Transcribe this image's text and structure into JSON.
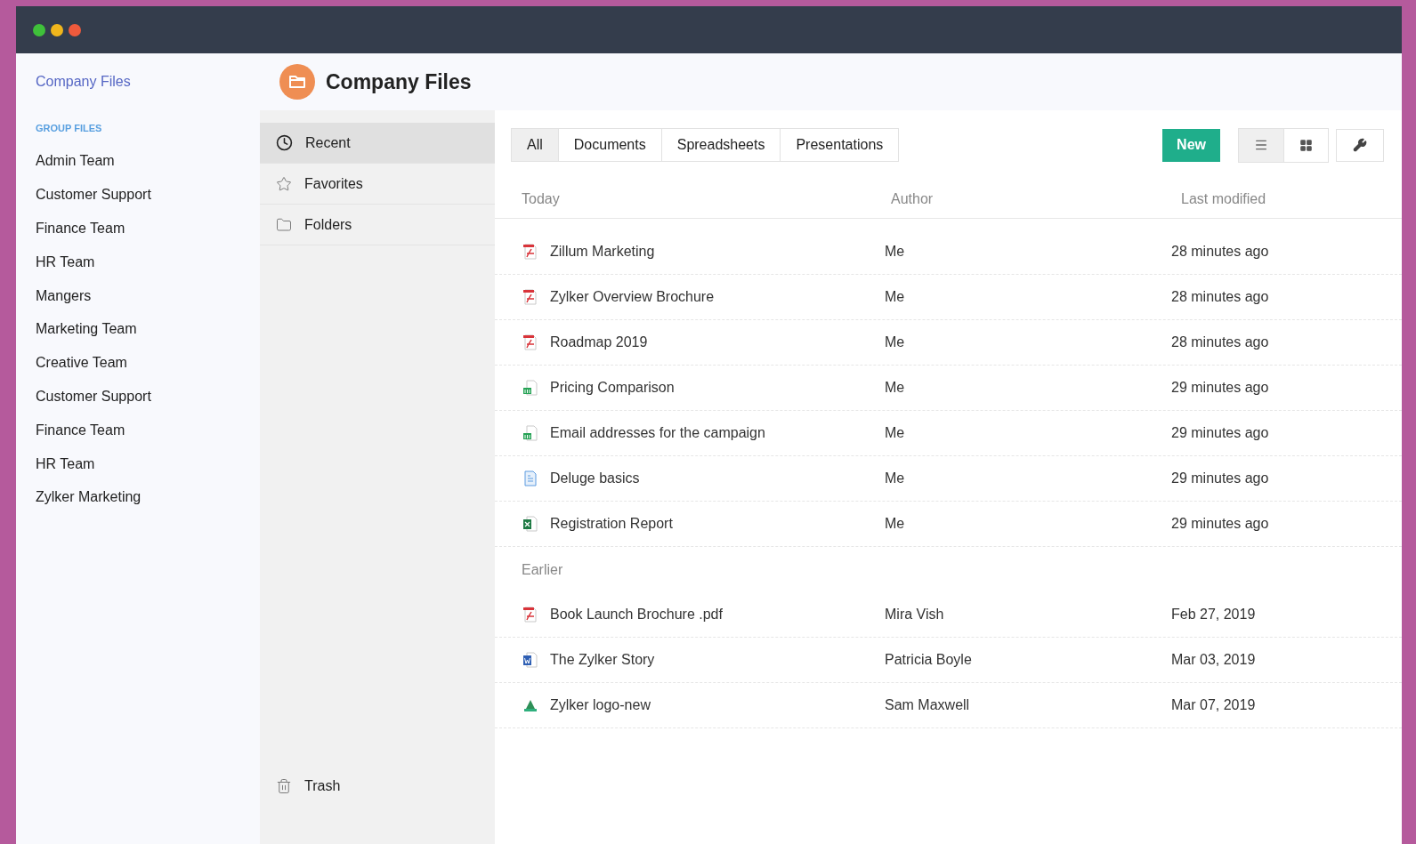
{
  "window": {
    "controls": [
      {
        "color": "#3fc13a"
      },
      {
        "color": "#f0b61c"
      },
      {
        "color": "#ef5a3c"
      }
    ]
  },
  "sidebar": {
    "title": "Company Files",
    "section_label": "GROUP FILES",
    "items": [
      {
        "label": "Admin Team"
      },
      {
        "label": "Customer Support"
      },
      {
        "label": "Finance Team"
      },
      {
        "label": "HR Team"
      },
      {
        "label": "Mangers"
      },
      {
        "label": "Marketing Team"
      },
      {
        "label": "Creative Team"
      },
      {
        "label": "Customer Support"
      },
      {
        "label": "Finance Team"
      },
      {
        "label": "HR Team"
      },
      {
        "label": "Zylker Marketing"
      }
    ]
  },
  "header": {
    "title": "Company Files"
  },
  "nav": {
    "items": [
      {
        "label": "Recent",
        "kind": "recent",
        "selected": true
      },
      {
        "label": "Favorites",
        "kind": "favorites",
        "selected": false
      },
      {
        "label": "Folders",
        "kind": "folders",
        "selected": false
      }
    ],
    "trash": {
      "label": "Trash"
    }
  },
  "tabs": [
    {
      "label": "All",
      "selected": true
    },
    {
      "label": "Documents",
      "selected": false
    },
    {
      "label": "Spreadsheets",
      "selected": false
    },
    {
      "label": "Presentations",
      "selected": false
    }
  ],
  "new_button": "New",
  "view_toggle": [
    {
      "kind": "list",
      "selected": true
    },
    {
      "kind": "grid",
      "selected": false
    }
  ],
  "table": {
    "columns": [
      "Today",
      "Author",
      "Last modified"
    ],
    "rows": [
      {
        "kind": "pdf",
        "name": "Zillum Marketing",
        "author": "Me",
        "modified": "28 minutes ago"
      },
      {
        "kind": "pdf",
        "name": "Zylker Overview Brochure",
        "author": "Me",
        "modified": "28 minutes ago"
      },
      {
        "kind": "pdf",
        "name": "Roadmap 2019",
        "author": "Me",
        "modified": "28 minutes ago"
      },
      {
        "kind": "sheet",
        "name": "Pricing Comparison",
        "author": "Me",
        "modified": "29 minutes ago"
      },
      {
        "kind": "sheet",
        "name": "Email addresses for the campaign",
        "author": "Me",
        "modified": "29 minutes ago"
      },
      {
        "kind": "doc",
        "name": "Deluge basics",
        "author": "Me",
        "modified": "29 minutes ago"
      },
      {
        "kind": "excel",
        "name": "Registration Report",
        "author": "Me",
        "modified": "29 minutes ago"
      }
    ],
    "sections": [
      {
        "label": "Earlier",
        "rows": [
          {
            "kind": "pdf",
            "name": "Book Launch Brochure .pdf",
            "author": "Mira Vish",
            "modified": "Feb 27, 2019"
          },
          {
            "kind": "word",
            "name": "The Zylker Story",
            "author": "Patricia Boyle",
            "modified": "Mar 03, 2019"
          },
          {
            "kind": "image",
            "name": "Zylker logo-new",
            "author": "Sam Maxwell",
            "modified": "Mar 07, 2019"
          }
        ]
      }
    ]
  }
}
